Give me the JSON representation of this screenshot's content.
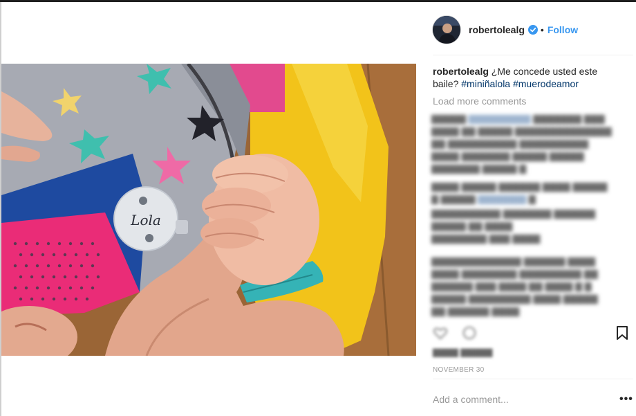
{
  "post": {
    "username": "robertolealg",
    "follow_label": "Follow",
    "separator": "•",
    "caption": {
      "username": "robertolealg",
      "text": "¿Me concede usted este baile?",
      "hashtags": [
        "#miniñalola",
        "#muerodeamor"
      ]
    },
    "load_more_label": "Load more comments",
    "date": "NOVEMBER 30",
    "add_comment_placeholder": "Add a comment...",
    "more_options": "•••",
    "pacifier_text": "Lola"
  },
  "colors": {
    "follow_blue": "#3897f0",
    "hashtag_blue": "#003569",
    "verified_blue": "#3897f0",
    "muted_gray": "#999999"
  },
  "icons": {
    "verified": "verified-badge-icon",
    "bookmark": "bookmark-icon",
    "like": "heart-icon",
    "comment": "comment-icon",
    "more": "more-options-icon"
  }
}
